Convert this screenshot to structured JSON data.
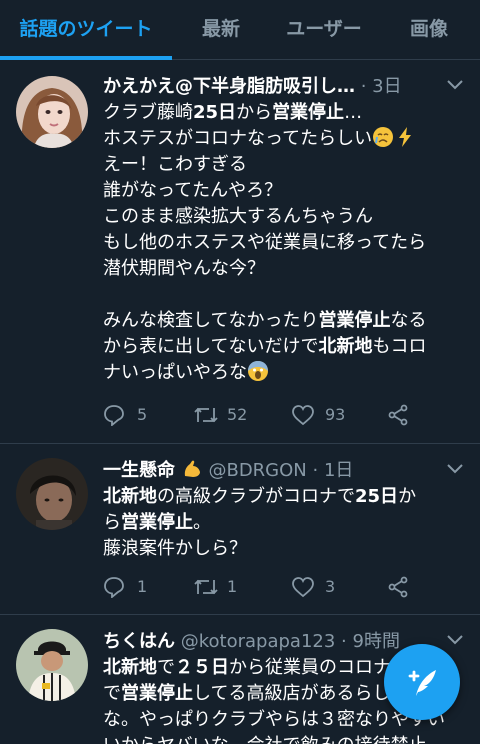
{
  "tabs": [
    {
      "label": "話題のツイート",
      "active": true
    },
    {
      "label": "最新",
      "active": false
    },
    {
      "label": "ユーザー",
      "active": false
    },
    {
      "label": "画像",
      "active": false
    }
  ],
  "tweets": [
    {
      "name": "かえかえ@下半身脂肪吸引し…",
      "handle": "",
      "time": "· 3日",
      "lines": [
        [
          {
            "t": "クラブ藤崎"
          },
          {
            "t": "25日",
            "b": true
          },
          {
            "t": "から"
          },
          {
            "t": "営業停止",
            "b": true
          },
          {
            "t": "…"
          }
        ],
        [
          {
            "t": "ホステスがコロナなってたらしい"
          }
        ],
        [
          {
            "t": "えー！こわすぎる"
          }
        ],
        [
          {
            "t": "誰がなってたんやろ？"
          }
        ],
        [
          {
            "t": "このまま感染拡大するんちゃうん"
          }
        ],
        [
          {
            "t": "もし他のホステスや従業員に移ってたら"
          }
        ],
        [
          {
            "t": "潜伏期間やんな今？"
          }
        ],
        [
          {
            "t": ""
          }
        ],
        [
          {
            "t": "みんな検査してなかったり"
          },
          {
            "t": "営業停止",
            "b": true
          },
          {
            "t": "なる"
          }
        ],
        [
          {
            "t": "から表に出してないだけで"
          },
          {
            "t": "北新地",
            "b": true
          },
          {
            "t": "もコロ"
          }
        ],
        [
          {
            "t": "ナいっぱいやろな"
          }
        ]
      ],
      "replies": "5",
      "retweets": "52",
      "likes": "93"
    },
    {
      "name": "一生懸命",
      "handle": "@BDRGON",
      "time": "· 1日",
      "lines": [
        [
          {
            "t": "北新地",
            "b": true
          },
          {
            "t": "の高級クラブがコロナで"
          },
          {
            "t": "25日",
            "b": true
          },
          {
            "t": "か"
          }
        ],
        [
          {
            "t": "ら"
          },
          {
            "t": "営業停止",
            "b": true
          },
          {
            "t": "。"
          }
        ],
        [
          {
            "t": "藤浪案件かしら？"
          }
        ]
      ],
      "replies": "1",
      "retweets": "1",
      "likes": "3"
    },
    {
      "name": "ちくはん",
      "handle": "@kotorapapa123",
      "time": "· 9時間",
      "lines": [
        [
          {
            "t": "北新地",
            "b": true
          },
          {
            "t": "で"
          },
          {
            "t": "２５日",
            "b": true
          },
          {
            "t": "から従業員のコロナ感染"
          }
        ],
        [
          {
            "t": "で"
          },
          {
            "t": "営業停止",
            "b": true
          },
          {
            "t": "してる高級店があるらしい"
          }
        ],
        [
          {
            "t": "な。やっぱりクラブやらは３密なりやすい"
          }
        ],
        [
          {
            "t": "いからヤバいな。会社で飲みの接待禁止"
          }
        ]
      ],
      "replies": "",
      "retweets": "",
      "likes": ""
    }
  ]
}
